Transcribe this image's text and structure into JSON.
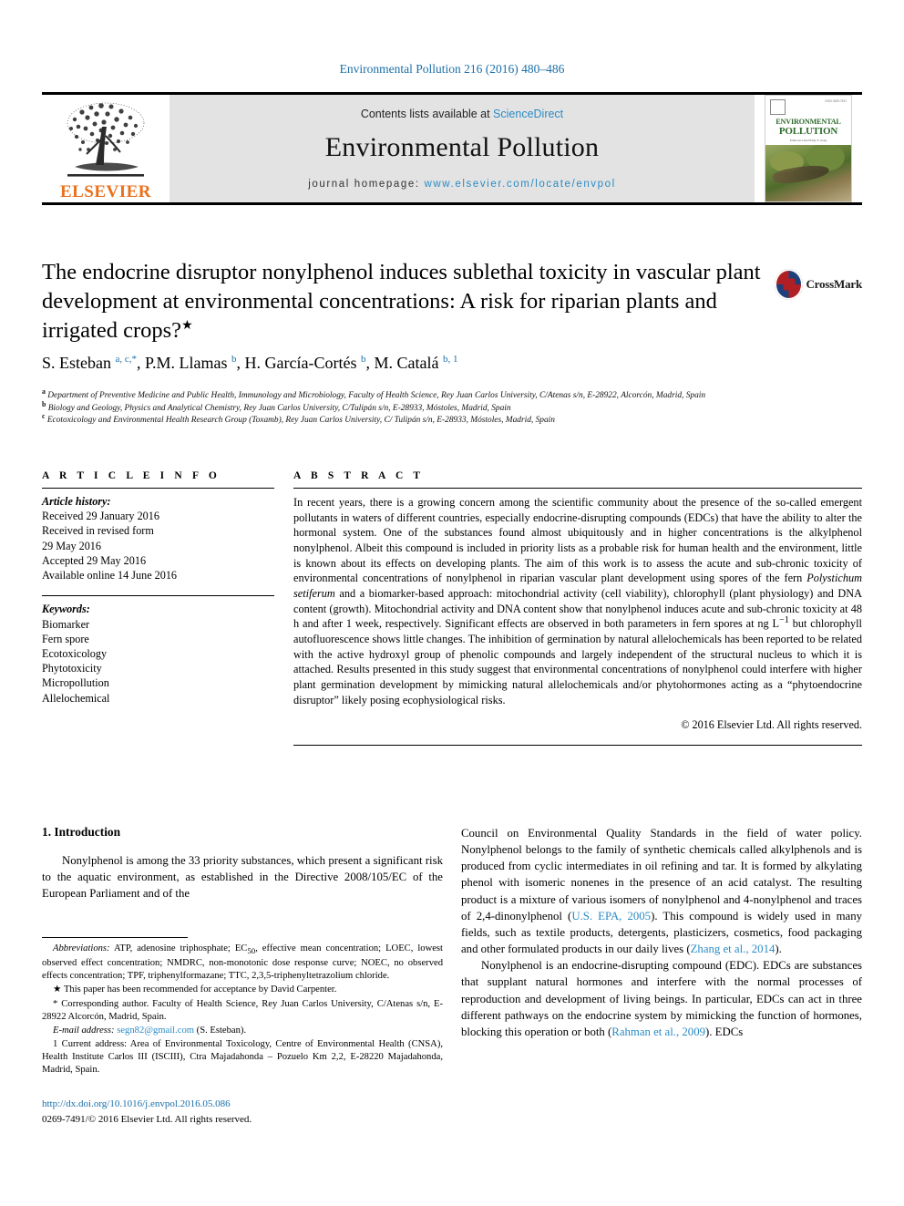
{
  "running_head": "Environmental Pollution 216 (2016) 480–486",
  "masthead": {
    "contents_prefix": "Contents lists available at ",
    "sciencedirect": "ScienceDirect",
    "journal_name": "Environmental Pollution",
    "homepage_label": "journal homepage: ",
    "homepage_url": "www.elsevier.com/locate/envpol",
    "publisher_wordmark": "ELSEVIER",
    "publisher_color": "#E9711C",
    "link_color": "#2a8bc4",
    "cover": {
      "title_line1": "ENVIRONMENTAL",
      "title_line2": "POLLUTION",
      "subtitle": "Editor-in-Chief\nEddy Y. Zeng",
      "corner_tag": "ISSN 0269-7491"
    }
  },
  "article": {
    "title": "The endocrine disruptor nonylphenol induces sublethal toxicity in vascular plant development at environmental concentrations: A risk for riparian plants and irrigated crops?",
    "title_marker": "★",
    "crossmark_label": "CrossMark",
    "authors_html": "S. Esteban <sup>a, c,</sup><sup>*</sup>, P.M. Llamas <sup>b</sup>, H. García-Cortés <sup>b</sup>, M. Catalá <sup>b, 1</sup>",
    "affiliations": [
      {
        "marker": "a",
        "text": "Department of Preventive Medicine and Public Health, Immunology and Microbiology, Faculty of Health Science, Rey Juan Carlos University, C/Atenas s/n, E-28922, Alcorcón, Madrid, Spain"
      },
      {
        "marker": "b",
        "text": "Biology and Geology, Physics and Analytical Chemistry, Rey Juan Carlos University, C/Tulipán s/n, E-28933, Móstoles, Madrid, Spain"
      },
      {
        "marker": "c",
        "text": "Ecotoxicology and Environmental Health Research Group (Toxamb), Rey Juan Carlos University, C/ Tulipán s/n, E-28933, Móstoles, Madrid, Spain"
      }
    ]
  },
  "article_info": {
    "heading": "A R T I C L E  I N F O",
    "history_label": "Article history:",
    "history": [
      "Received 29 January 2016",
      "Received in revised form",
      "29 May 2016",
      "Accepted 29 May 2016",
      "Available online 14 June 2016"
    ],
    "keywords_label": "Keywords:",
    "keywords": [
      "Biomarker",
      "Fern spore",
      "Ecotoxicology",
      "Phytotoxicity",
      "Micropollution",
      "Allelochemical"
    ]
  },
  "abstract": {
    "heading": "A B S T R A C T",
    "paragraph_1": "In recent years, there is a growing concern among the scientific community about the presence of the so-called emergent pollutants in waters of different countries, especially endocrine-disrupting compounds (EDCs) that have the ability to alter the hormonal system. One of the substances found almost ubiquitously and in higher concentrations is the alkylphenol nonylphenol. Albeit this compound is included in priority lists as a probable risk for human health and the environment, little is known about its effects on developing plants. The aim of this work is to assess the acute and sub-chronic toxicity of environmental concentrations of nonylphenol in riparian vascular plant development using spores of the fern ",
    "species": "Polystichum setiferum",
    "paragraph_2": " and a biomarker-based approach: mitochondrial activity (cell viability), chlorophyll (plant physiology) and DNA content (growth). Mitochondrial activity and DNA content show that nonylphenol induces acute and sub-chronic toxicity at 48 h and after 1 week, respectively. Significant effects are observed in both parameters in fern spores at ng L",
    "exponent": "−1",
    "paragraph_3": " but chlorophyll autofluorescence shows little changes. The inhibition of germination by natural allelochemicals has been reported to be related with the active hydroxyl group of phenolic compounds and largely independent of the structural nucleus to which it is attached. Results presented in this study suggest that environmental concentrations of nonylphenol could interfere with higher plant germination development by mimicking natural allelochemicals and/or phytohormones acting as a “phytoendocrine disruptor” likely posing ecophysiological risks.",
    "copyright": "© 2016 Elsevier Ltd. All rights reserved."
  },
  "body": {
    "section_number_title": "1. Introduction",
    "left_paragraph": "Nonylphenol is among the 33 priority substances, which present a significant risk to the aquatic environment, as established in the Directive 2008/105/EC of the European Parliament and of the",
    "right_paragraph_1_a": "Council on Environmental Quality Standards in the field of water policy. Nonylphenol belongs to the family of synthetic chemicals called alkylphenols and is produced from cyclic intermediates in oil refining and tar. It is formed by alkylating phenol with isomeric nonenes in the presence of an acid catalyst. The resulting product is a mixture of various isomers of nonylphenol and 4-nonylphenol and traces of 2,4-dinonylphenol (",
    "citation_1": "U.S. EPA, 2005",
    "right_paragraph_1_b": "). This compound is widely used in many fields, such as textile products, detergents, plasticizers, cosmetics, food packaging and other formulated products in our daily lives (",
    "citation_2": "Zhang et al., 2014",
    "right_paragraph_1_c": ").",
    "right_paragraph_2_a": "Nonylphenol is an endocrine-disrupting compound (EDC). EDCs are substances that supplant natural hormones and interfere with the normal processes of reproduction and development of living beings. In particular, EDCs can act in three different pathways on the endocrine system by mimicking the function of hormones, blocking this operation or both (",
    "citation_3": "Rahman et al., 2009",
    "right_paragraph_2_b": "). EDCs"
  },
  "footnotes": {
    "abbreviations_label": "Abbreviations:",
    "abbreviations_a": " ATP, adenosine triphosphate; EC",
    "abbreviations_sub": "50",
    "abbreviations_b": ", effective mean concentration; LOEC, lowest observed effect concentration; NMDRC, non-monotonic dose response curve; NOEC, no observed effects concentration; TPF, triphenylformazane; TTC, 2,3,5-triphenyltetrazolium chloride.",
    "star_note": "★ This paper has been recommended for acceptance by David Carpenter.",
    "corresponding": "* Corresponding author. Faculty of Health Science, Rey Juan Carlos University, C/Atenas s/n, E-28922 Alcorcón, Madrid, Spain.",
    "email_label": "E-mail address:",
    "email": "segn82@gmail.com",
    "email_suffix": " (S. Esteban).",
    "note_1": "1 Current address: Area of Environmental Toxicology, Centre of Environmental Health (CNSA), Health Institute Carlos III (ISCIII), Ctra Majadahonda – Pozuelo Km 2,2, E-28220 Majadahonda, Madrid, Spain."
  },
  "footer": {
    "doi": "http://dx.doi.org/10.1016/j.envpol.2016.05.086",
    "issn_line": "0269-7491/© 2016 Elsevier Ltd. All rights reserved."
  }
}
